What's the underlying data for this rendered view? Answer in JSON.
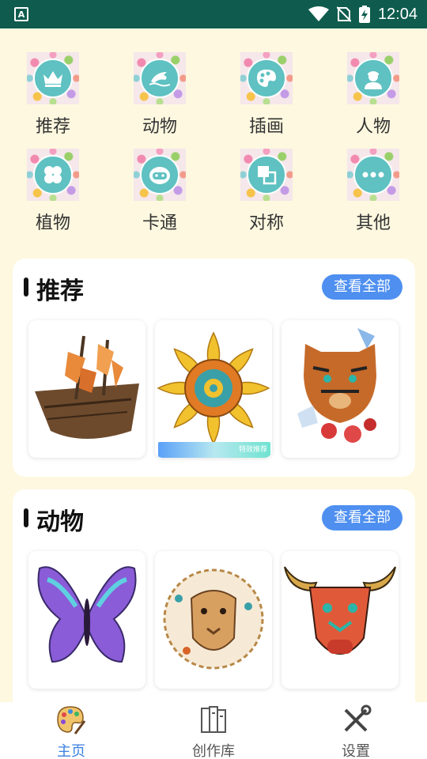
{
  "statusbar": {
    "time": "12:04",
    "app_badge": "A"
  },
  "categories": [
    {
      "label": "推荐",
      "icon": "crown-icon"
    },
    {
      "label": "动物",
      "icon": "dolphin-icon"
    },
    {
      "label": "插画",
      "icon": "palette-icon"
    },
    {
      "label": "人物",
      "icon": "person-icon"
    },
    {
      "label": "植物",
      "icon": "clover-icon"
    },
    {
      "label": "卡通",
      "icon": "robot-face-icon"
    },
    {
      "label": "对称",
      "icon": "symmetry-icon"
    },
    {
      "label": "其他",
      "icon": "more-icon"
    }
  ],
  "sections": [
    {
      "title": "推荐",
      "view_all": "查看全部",
      "cards": [
        {
          "subject": "ship"
        },
        {
          "subject": "mandala",
          "ad_text": "特效推荐"
        },
        {
          "subject": "tiger"
        }
      ]
    },
    {
      "title": "动物",
      "view_all": "查看全部",
      "cards": [
        {
          "subject": "butterfly"
        },
        {
          "subject": "lion"
        },
        {
          "subject": "bull"
        }
      ]
    }
  ],
  "bottom_nav": [
    {
      "label": "主页",
      "icon": "palette-brush-icon",
      "active": true
    },
    {
      "label": "创作库",
      "icon": "library-icon",
      "active": false
    },
    {
      "label": "设置",
      "icon": "tools-icon",
      "active": false
    }
  ],
  "colors": {
    "accent": "#4e8ff0",
    "status_bar": "#0f5c4e",
    "background": "#fdf8df",
    "category_circle": "#5fc1c1"
  }
}
